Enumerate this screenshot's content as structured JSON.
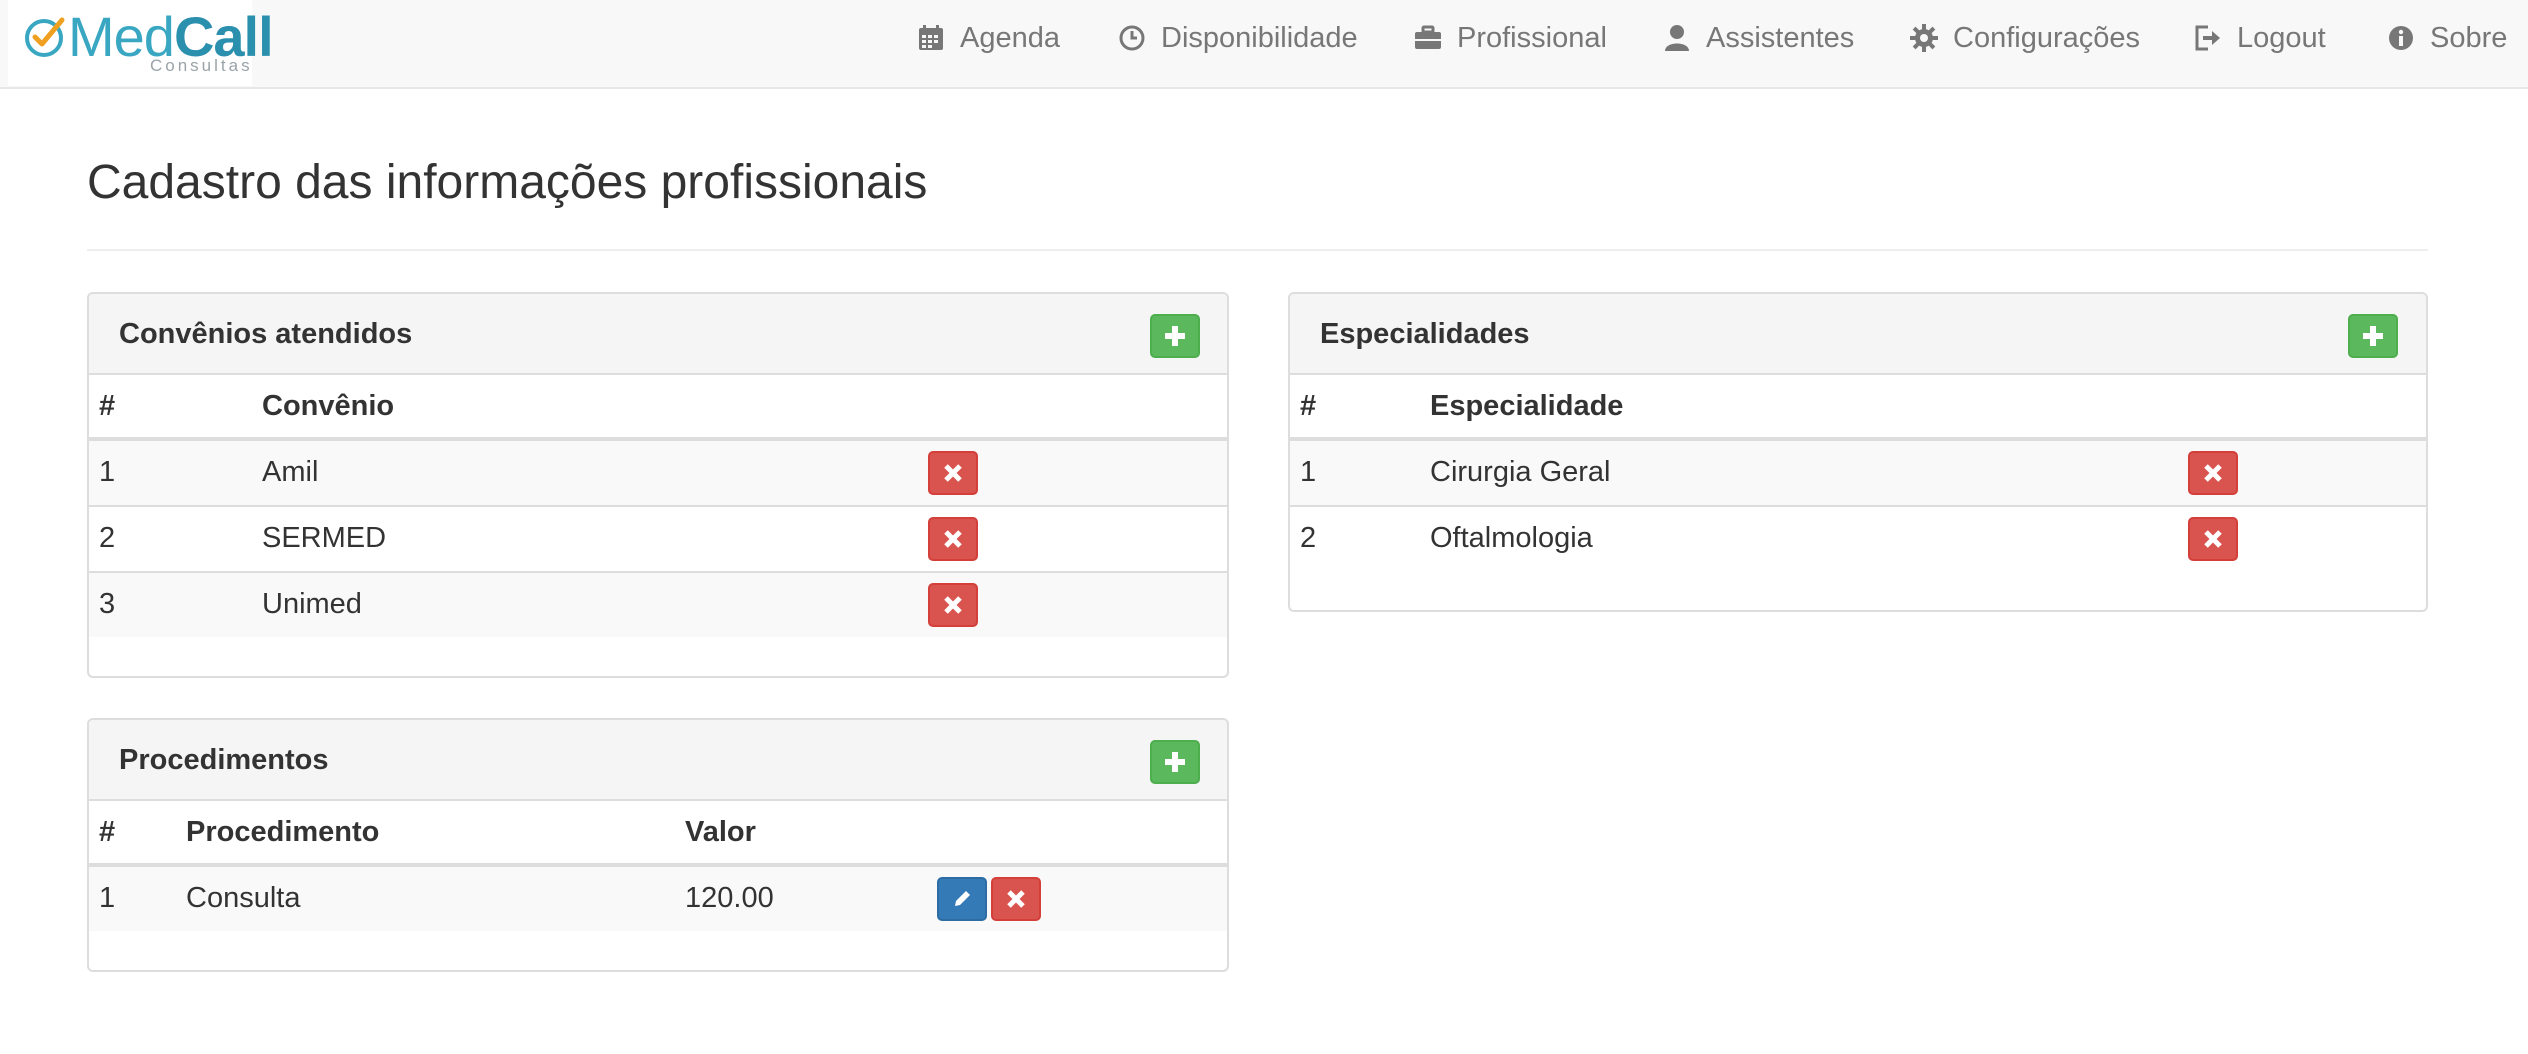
{
  "brand": {
    "name_part1": "Med",
    "name_part2": "Call",
    "subtitle": "Consultas"
  },
  "nav": {
    "items": [
      {
        "label": "Agenda",
        "icon": "calendar-icon"
      },
      {
        "label": "Disponibilidade",
        "icon": "clock-icon"
      },
      {
        "label": "Profissional",
        "icon": "briefcase-icon"
      },
      {
        "label": "Assistentes",
        "icon": "user-icon"
      },
      {
        "label": "Configurações",
        "icon": "gear-icon"
      },
      {
        "label": "Logout",
        "icon": "logout-icon"
      },
      {
        "label": "Sobre",
        "icon": "info-icon"
      }
    ]
  },
  "page": {
    "title": "Cadastro das informações profissionais"
  },
  "convenios": {
    "title": "Convênios atendidos",
    "headers": {
      "num": "#",
      "name": "Convênio"
    },
    "rows": [
      {
        "num": "1",
        "name": "Amil"
      },
      {
        "num": "2",
        "name": "SERMED"
      },
      {
        "num": "3",
        "name": "Unimed"
      }
    ]
  },
  "especialidades": {
    "title": "Especialidades",
    "headers": {
      "num": "#",
      "name": "Especialidade"
    },
    "rows": [
      {
        "num": "1",
        "name": "Cirurgia Geral"
      },
      {
        "num": "2",
        "name": "Oftalmologia"
      }
    ]
  },
  "procedimentos": {
    "title": "Procedimentos",
    "headers": {
      "num": "#",
      "name": "Procedimento",
      "value": "Valor"
    },
    "rows": [
      {
        "num": "1",
        "name": "Consulta",
        "value": "120.00"
      }
    ]
  },
  "colors": {
    "success": "#5cb85c",
    "danger": "#d9534f",
    "primary": "#337ab7",
    "brand": "#2b8fae"
  }
}
